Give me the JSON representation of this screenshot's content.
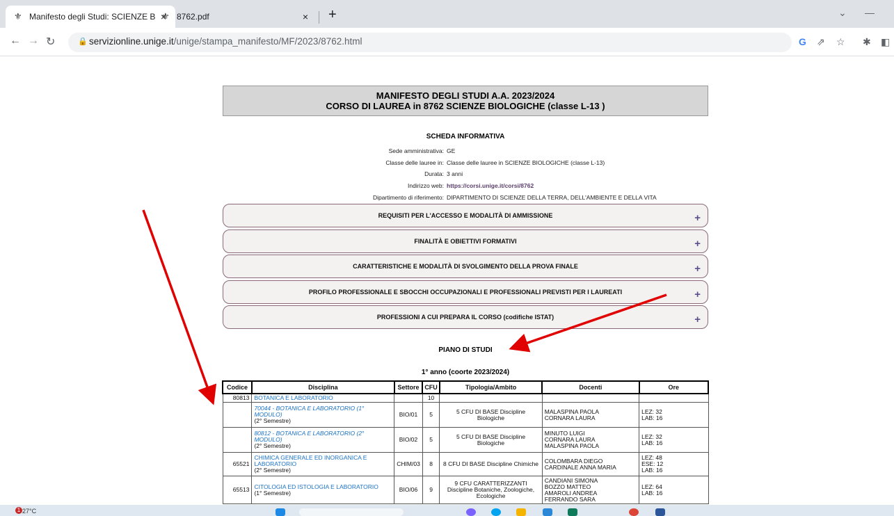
{
  "browser": {
    "tabs": [
      {
        "title": "Manifesto degli Studi: SCIENZE B",
        "close": "×"
      },
      {
        "title": "8762.pdf",
        "close": "×"
      }
    ],
    "new_tab": "+",
    "url_host": "servizionline.unige.it",
    "url_path": "/unige/stampa_manifesto/MF/2023/8762.html",
    "icons": [
      "back-icon",
      "forward-icon",
      "reload-icon",
      "lock-icon",
      "google-icon",
      "share-icon",
      "star-icon",
      "extensions-icon",
      "sidepanel-icon"
    ]
  },
  "header": {
    "line1": "MANIFESTO DEGLI STUDI A.A. 2023/2024",
    "line2": "CORSO DI LAUREA in 8762 SCIENZE BIOLOGICHE (classe L-13 )"
  },
  "scheda": {
    "title": "SCHEDA INFORMATIVA",
    "rows": [
      {
        "label": "Sede amministrativa:",
        "value": "GE"
      },
      {
        "label": "Classe delle lauree in:",
        "value": "Classe delle lauree in SCIENZE BIOLOGICHE (classe L-13)"
      },
      {
        "label": "Durata:",
        "value": "3 anni"
      },
      {
        "label": "Indirizzo web:",
        "value": "https://corsi.unige.it/corsi/8762"
      },
      {
        "label": "Dipartimento di riferimento:",
        "value": "DIPARTIMENTO DI SCIENZE DELLA TERRA, DELL'AMBIENTE E DELLA VITA"
      }
    ]
  },
  "accordion": [
    {
      "label": "REQUISITI PER L'ACCESSO E MODALITÀ DI AMMISSIONE",
      "icon": "+"
    },
    {
      "label": "FINALITÀ E OBIETTIVI FORMATIVI",
      "icon": "+"
    },
    {
      "label": "CARATTERISTICHE E MODALITÀ DI SVOLGIMENTO DELLA PROVA FINALE",
      "icon": "+"
    },
    {
      "label": "PROFILO PROFESSIONALE E SBOCCHI OCCUPAZIONALI E PROFESSIONALI PREVISTI PER I LAUREATI",
      "icon": "+"
    },
    {
      "label": "PROFESSIONI A CUI PREPARA IL CORSO (codifiche ISTAT)",
      "icon": "+"
    }
  ],
  "piano": {
    "title": "PIANO DI STUDI",
    "year": "1° anno (coorte 2023/2024)",
    "headers": [
      "Codice",
      "Disciplina",
      "Settore",
      "CFU",
      "Tipologia/Ambito",
      "Docenti",
      "Ore"
    ],
    "rows": [
      {
        "codice": "80813",
        "disc": "BOTANICA E LABORATORIO",
        "disc_italic": "",
        "sem": "",
        "settore": "",
        "cfu": "10",
        "tip": "",
        "doc": "",
        "ore": ""
      },
      {
        "codice": "",
        "disc": "",
        "disc_italic": "70044 - BOTANICA E LABORATORIO (1° MODULO)",
        "sem": "(2° Semestre)",
        "settore": "BIO/01",
        "cfu": "5",
        "tip": "5 CFU DI BASE Discipline Biologiche",
        "doc": "MALASPINA PAOLA\nCORNARA LAURA",
        "ore": "LEZ: 32\nLAB: 16"
      },
      {
        "codice": "",
        "disc": "",
        "disc_italic": "80812 - BOTANICA E LABORATORIO (2° MODULO)",
        "sem": "(2° Semestre)",
        "settore": "BIO/02",
        "cfu": "5",
        "tip": "5 CFU DI BASE Discipline Biologiche",
        "doc": "MINUTO LUIGI\nCORNARA LAURA\nMALASPINA PAOLA",
        "ore": "LEZ: 32\nLAB: 16"
      },
      {
        "codice": "65521",
        "disc": "CHIMICA GENERALE ED INORGANICA E LABORATORIO",
        "disc_italic": "",
        "sem": "(2° Semestre)",
        "settore": "CHIM/03",
        "cfu": "8",
        "tip": "8 CFU DI BASE Discipline Chimiche",
        "doc": "COLOMBARA DIEGO\nCARDINALE ANNA MARIA",
        "ore": "LEZ: 48\nESE: 12\nLAB: 16"
      },
      {
        "codice": "65513",
        "disc": "CITOLOGIA ED ISTOLOGIA E LABORATORIO",
        "disc_italic": "",
        "sem": "(1° Semestre)",
        "settore": "BIO/06",
        "cfu": "9",
        "tip": "9 CFU CARATTERIZZANTI Discipline Botaniche, Zoologiche, Ecologiche",
        "doc": "CANDIANI SIMONA\nBOZZO MATTEO\nAMAROLI ANDREA\nFERRANDO SARA",
        "ore": "LEZ: 64\nLAB: 16"
      }
    ]
  },
  "taskbar": {
    "weather": "27°C",
    "badge": "1"
  }
}
